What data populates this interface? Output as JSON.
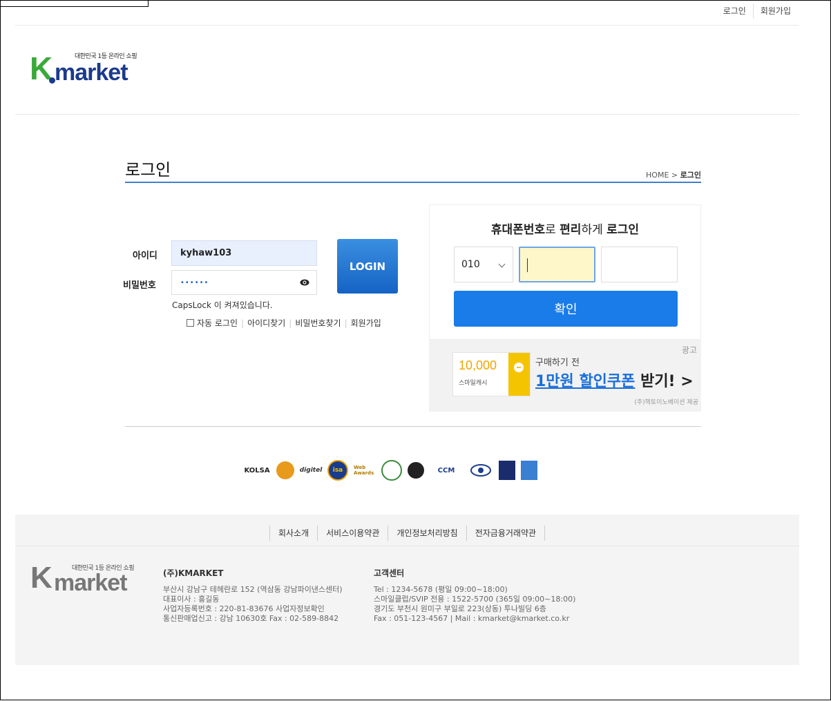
{
  "top_links": [
    "로그인",
    "회원가입"
  ],
  "logo": {
    "tagline": "대한민국 1등 온라인 쇼핑",
    "k": "K",
    "rest": "market"
  },
  "page": {
    "title": "로그인",
    "breadcrumb_home": "HOME >",
    "breadcrumb_current": "로그인"
  },
  "login_form": {
    "id_label": "아이디",
    "id_value": "kyhaw103",
    "pw_label": "비밀번호",
    "pw_value": "••••••",
    "login_button": "LOGIN",
    "caps_warning": "CapsLock 이 켜져있습니다.",
    "auto_login": "자동 로그인",
    "find_id": "아이디찾기",
    "find_pw": "비밀번호찾기",
    "signup": "회원가입"
  },
  "phone_login": {
    "title_1": "휴대폰번호",
    "title_2": "로 ",
    "title_3": "편리",
    "title_4": "하게 ",
    "title_5": "로그인",
    "prefix": "010",
    "confirm": "확인"
  },
  "ad": {
    "label": "광고",
    "amount": "10,000",
    "cash": "스마일캐시",
    "pre": "구매하기 전",
    "main_hl": "1만원 할인쿠폰",
    "main_rest": " 받기! >",
    "provider": "(주)헥토이노베이션 제공"
  },
  "badges": [
    "KOLSA",
    "",
    "digitel",
    "isa",
    "Web Awards",
    "",
    "",
    "CCM",
    "",
    "",
    ""
  ],
  "footer": {
    "links": [
      "회사소개",
      "서비스이용약관",
      "개인정보처리방침",
      "전자금융거래약관"
    ],
    "company_title": "(주)KMARKET",
    "company_lines": [
      "부산시 강남구 테헤란로 152 (역삼동 강남파이낸스센터)",
      "대표이사 : 홍길동",
      "사업자등록번호 : 220-81-83676 사업자정보확인",
      "통신판매업신고 : 강남 10630호 Fax : 02-589-8842"
    ],
    "cs_title": "고객센터",
    "cs_lines": [
      "Tel : 1234-5678 (평일 09:00~18:00)",
      "스마일클럽/SVIP 전용 : 1522-5700 (365일 09:00~18:00)",
      "경기도 부천시 원미구 부일로 223(상동) 투나빌딩 6층",
      "Fax : 051-123-4567 | Mail : kmarket@kmarket.co.kr"
    ]
  },
  "colors": {
    "brand_green": "#3aa93a",
    "brand_navy": "#1b3a8c",
    "accent_blue": "#1a7ce8"
  }
}
